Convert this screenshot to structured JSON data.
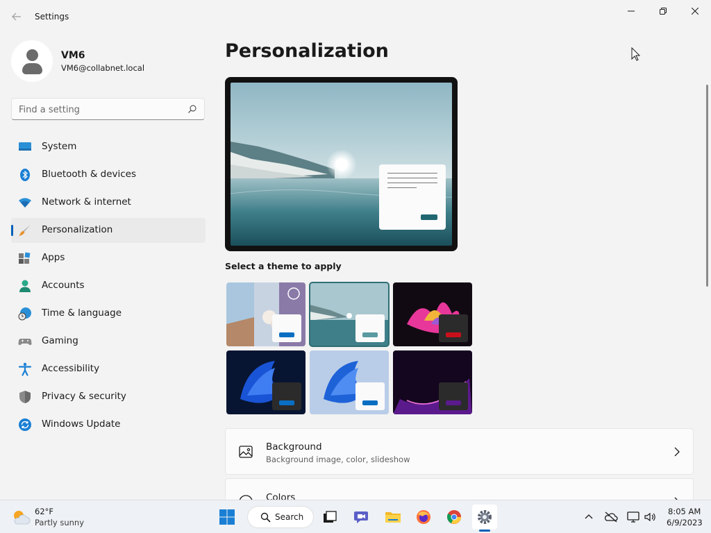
{
  "window": {
    "title": "Settings"
  },
  "user": {
    "name": "VM6",
    "email": "VM6@collabnet.local"
  },
  "search": {
    "placeholder": "Find a setting",
    "value": ""
  },
  "nav": {
    "items": [
      {
        "label": "System",
        "icon": "monitor-icon"
      },
      {
        "label": "Bluetooth & devices",
        "icon": "bluetooth-icon"
      },
      {
        "label": "Network & internet",
        "icon": "wifi-icon"
      },
      {
        "label": "Personalization",
        "icon": "paintbrush-icon",
        "active": true
      },
      {
        "label": "Apps",
        "icon": "apps-icon"
      },
      {
        "label": "Accounts",
        "icon": "person-icon"
      },
      {
        "label": "Time & language",
        "icon": "globe-clock-icon"
      },
      {
        "label": "Gaming",
        "icon": "gamepad-icon"
      },
      {
        "label": "Accessibility",
        "icon": "accessibility-icon"
      },
      {
        "label": "Privacy & security",
        "icon": "shield-icon"
      },
      {
        "label": "Windows Update",
        "icon": "update-icon"
      }
    ]
  },
  "main": {
    "title": "Personalization",
    "theme_label": "Select a theme to apply",
    "themes": [
      {
        "name": "theme-1",
        "accent": "#0a6fc2",
        "window": "light"
      },
      {
        "name": "theme-2",
        "accent": "#5a9aa0",
        "window": "light",
        "selected": true
      },
      {
        "name": "theme-3",
        "accent": "#c8101c",
        "window": "dark"
      },
      {
        "name": "theme-4",
        "accent": "#0a6fc2",
        "window": "dark"
      },
      {
        "name": "theme-5",
        "accent": "#0a6fc2",
        "window": "light"
      },
      {
        "name": "theme-6",
        "accent": "#5b1a8c",
        "window": "dark"
      }
    ],
    "cards": [
      {
        "title": "Background",
        "subtitle": "Background image, color, slideshow",
        "icon": "image-icon"
      },
      {
        "title": "Colors",
        "subtitle": "",
        "icon": "palette-icon"
      }
    ]
  },
  "taskbar": {
    "weather": {
      "temp": "62°F",
      "desc": "Partly sunny"
    },
    "search_label": "Search",
    "time": "8:05 AM",
    "date": "6/9/2023"
  },
  "colors": {
    "accent": "#005fb8",
    "background": "#f3f3f3",
    "card": "#fbfbfb"
  }
}
